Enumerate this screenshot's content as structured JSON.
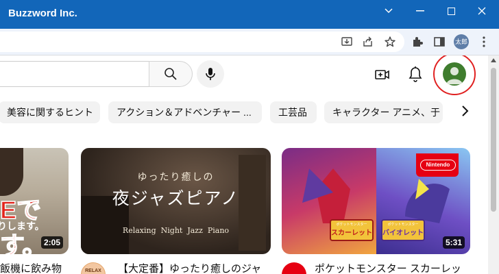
{
  "window": {
    "title": "Buzzword Inc."
  },
  "toolbar": {
    "profile_label": "太郎"
  },
  "header": {
    "search_placeholder": ""
  },
  "chips": [
    {
      "label": "美容に関するヒント"
    },
    {
      "label": "アクション＆アドベンチャー ..."
    },
    {
      "label": "工芸品"
    },
    {
      "label": "キャラクター アニメ、于"
    }
  ],
  "videos": [
    {
      "overlay_big": "Eです。",
      "overlay_small": "りします。",
      "duration": "2:05",
      "title": "飯機に飲み物"
    },
    {
      "overlay_sub": "ゆったり癒しの",
      "overlay_main": "夜ジャズピアノ",
      "overlay_caption": "Relaxing  Night  Jazz  Piano",
      "duration": "",
      "title": "【大定番】ゆったり癒しのジャ",
      "channel_avatar_text": "RELAX"
    },
    {
      "badge": "Nintendo",
      "logo_left_top": "ポケットモンスター",
      "logo_left_main": "スカーレット",
      "logo_right_top": "ポケットモンスター",
      "logo_right_main": "バイオレット",
      "duration": "5:31",
      "title": "ポケットモンスター スカーレッ"
    }
  ],
  "colors": {
    "titlebar": "#1266b9",
    "highlight_circle": "#e02020",
    "avatar": "#3f7d2e"
  }
}
